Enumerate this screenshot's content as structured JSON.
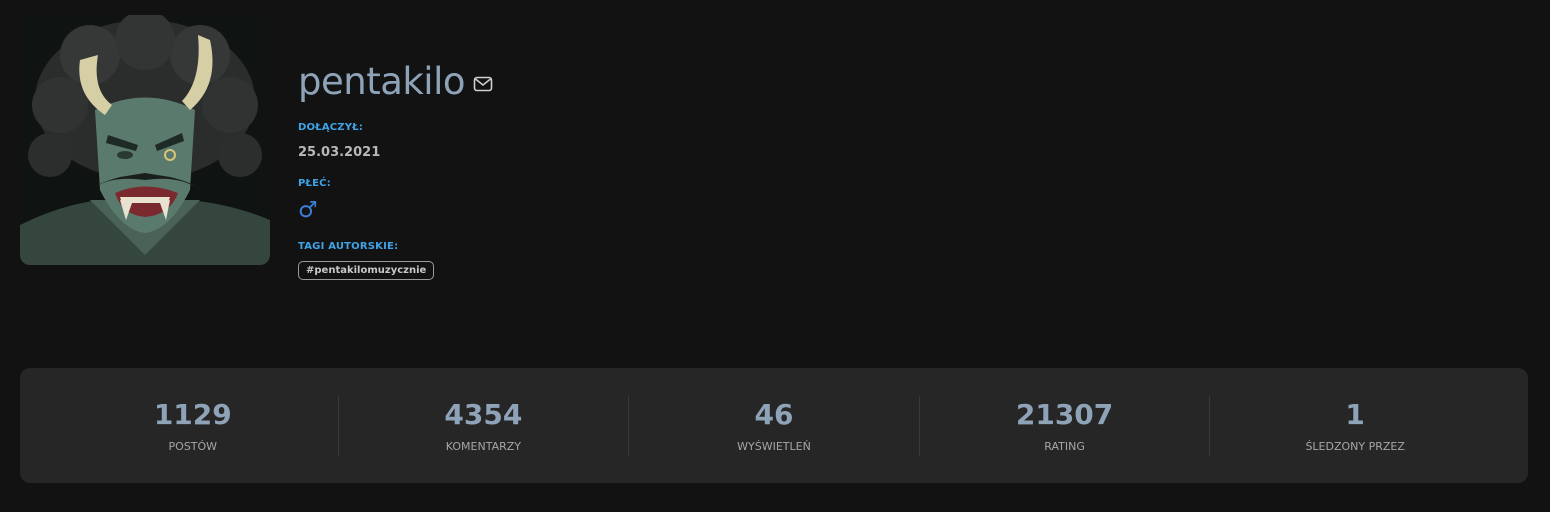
{
  "profile": {
    "username": "pentakilo",
    "joined_label": "DOŁĄCZYŁ:",
    "joined_value": "25.03.2021",
    "gender_label": "PŁEĆ:",
    "gender_value": "♂",
    "tags_label": "TAGI AUTORSKIE:",
    "tags": [
      "#pentakilomuzycznie"
    ],
    "icons": {
      "message": "mail-icon",
      "gender": "male-symbol-icon"
    },
    "colors": {
      "username": "#8ea3b8",
      "label": "#3fa3e6",
      "gender": "#3b7fd8"
    }
  },
  "stats": [
    {
      "value": "1129",
      "label": "POSTÓW"
    },
    {
      "value": "4354",
      "label": "KOMENTARZY"
    },
    {
      "value": "46",
      "label": "WYŚWIETLEŃ"
    },
    {
      "value": "21307",
      "label": "RATING"
    },
    {
      "value": "1",
      "label": "ŚLEDZONY PRZEZ"
    }
  ]
}
